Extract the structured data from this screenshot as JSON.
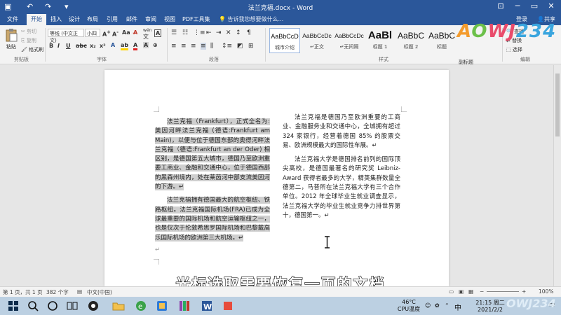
{
  "window": {
    "title": "法兰克福.docx - Word",
    "login": "登录",
    "share": "共享"
  },
  "tabs": [
    "文件",
    "开始",
    "插入",
    "设计",
    "布局",
    "引用",
    "邮件",
    "审阅",
    "视图",
    "PDF工具集"
  ],
  "tell_me": "告诉我您想要做什么...",
  "ribbon": {
    "clipboard": {
      "paste": "粘贴",
      "cut": "剪切",
      "copy": "复制",
      "format_painter": "格式刷",
      "group": "剪贴板"
    },
    "font": {
      "name": "等线 (中文正文)",
      "size": "小四",
      "group": "字体",
      "wen": "wén",
      "wen_char": "文",
      "a_char": "A"
    },
    "paragraph": {
      "group": "段落"
    },
    "styles": {
      "group": "样式",
      "items": [
        {
          "preview": "AaBbCcD",
          "name": "城市介绍"
        },
        {
          "preview": "AaBbCcDc",
          "name": "↵正文"
        },
        {
          "preview": "AaBbCcDc",
          "name": "↵无间隔"
        },
        {
          "preview": "AaBl",
          "name": "标题 1"
        },
        {
          "preview": "AaBbC",
          "name": "标题 2"
        },
        {
          "preview": "AaBbC",
          "name": "标题"
        }
      ]
    },
    "editing": {
      "find": "查找",
      "replace": "替换",
      "select": "选择",
      "group": "编辑",
      "extra": "副标题"
    }
  },
  "document": {
    "col1": [
      "法兰克福（Frankfurt），正式全名为: 美因河畔法兰克福 (德语:Frankfurt am Main)，以便与位于德国东部的奥得河畔法兰克福（德语:Frankfurt an der Oder) 相区别，是德国第五大城市，德国乃至欧洲重要工商业、金融和交通中心，位于德国西部的黑森州境内，处在莱茵河中部支流美因河的下游。↵",
      "法兰克福拥有德国最大的航空枢纽、铁路枢纽。法兰克福国际机场(FRA)已成为全球最重要的国际机场和航空运输枢纽之一，也是仅次于伦敦希思罗国际机场和巴黎戴高乐国际机场的欧洲第三大机场。↵",
      "↵"
    ],
    "col2": [
      "法兰克福是德国乃至欧洲重要的工商业、金融服务业和交通中心，全城拥有超过 324 家银行，经营着德国 85% 的股票交易、欧洲规模最大的国际性车展。↵",
      "法兰克福大学是德国排名前列的国际顶尖高校，是德国最著名的研究奖 Leibniz-Award 获得者最多的大学，精英集群数量全德第二，马普所在法兰克福大学有三个合作单位。2012 年全球毕业生就业调查显示，法兰克福大学的毕业生就业竞争力排世界第十，德国第一。↵"
    ]
  },
  "caption": "光标选取需要恢复一页的文档",
  "status": {
    "page": "第 1 页，共 1 页",
    "words": "382 个字",
    "lang": "中文(中国)",
    "zoom": "100%",
    "zoom_minus": "−",
    "zoom_plus": "+"
  },
  "taskbar": {
    "temp": "46°C",
    "cpu": "CPU温度",
    "ime": "中",
    "time": "21:15 周二",
    "date": "2021/2/2"
  },
  "watermark": {
    "a": "A",
    "b": "O",
    "c": "WJ",
    "d": "234",
    "small": "OWJ234"
  },
  "colors": {
    "word_blue": "#2b579a",
    "selection": "#cfcfcf",
    "ribbon": "#f3f3f3",
    "taskbar": "#bcd0e2"
  }
}
